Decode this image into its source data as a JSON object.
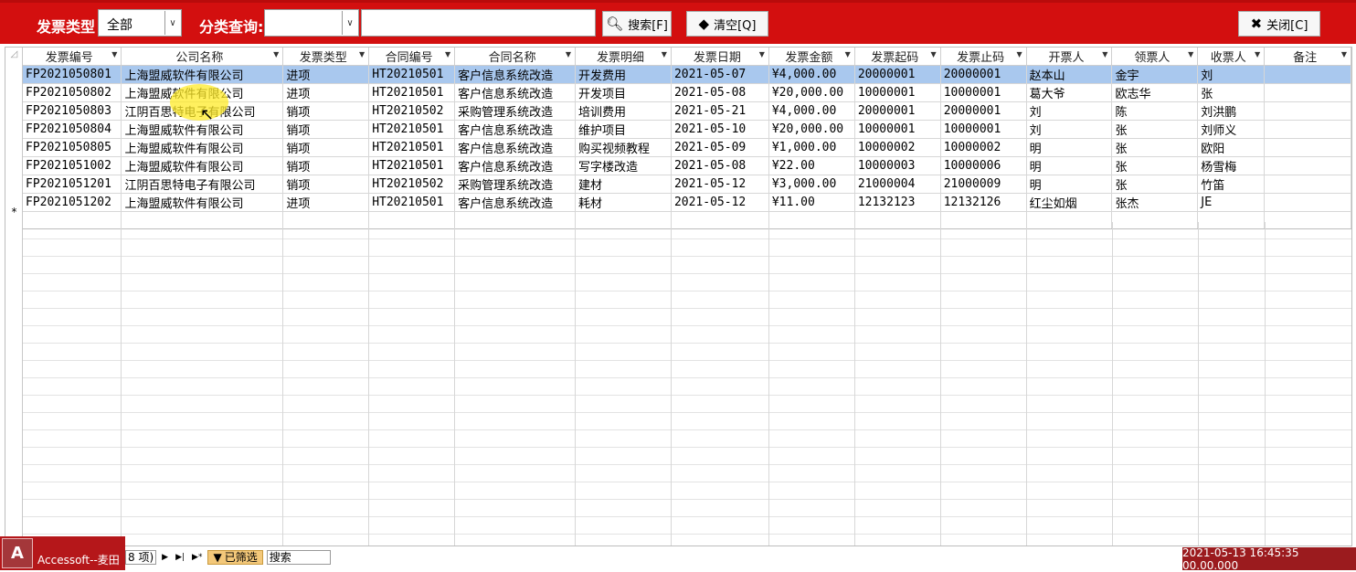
{
  "header": {
    "invoice_type_label": "发票类型",
    "invoice_type_value": "全部",
    "category_label": "分类查询:",
    "category_value": "",
    "query_value": "",
    "search_label": "搜索[F]",
    "clear_label": "清空[Q]",
    "close_label": "关闭[C]"
  },
  "columns": [
    "发票编号",
    "公司名称",
    "发票类型",
    "合同编号",
    "合同名称",
    "发票明细",
    "发票日期",
    "发票金额",
    "发票起码",
    "发票止码",
    "开票人",
    "领票人",
    "收票人",
    "备注"
  ],
  "rows": [
    [
      "FP2021050801",
      "上海盟威软件有限公司",
      "进项",
      "HT20210501",
      "客户信息系统改造",
      "开发费用",
      "2021-05-07",
      "¥4,000.00",
      "20000001",
      "20000001",
      "赵本山",
      "金宇",
      "刘",
      ""
    ],
    [
      "FP2021050802",
      "上海盟威软件有限公司",
      "进项",
      "HT20210501",
      "客户信息系统改造",
      "开发项目",
      "2021-05-08",
      "¥20,000.00",
      "10000001",
      "10000001",
      "葛大爷",
      "欧志华",
      "张",
      ""
    ],
    [
      "FP2021050803",
      "江阴百思特电子有限公司",
      "销项",
      "HT20210502",
      "采购管理系统改造",
      "培训费用",
      "2021-05-21",
      "¥4,000.00",
      "20000001",
      "20000001",
      "刘",
      "陈",
      "刘洪鹏",
      ""
    ],
    [
      "FP2021050804",
      "上海盟威软件有限公司",
      "销项",
      "HT20210501",
      "客户信息系统改造",
      "维护项目",
      "2021-05-10",
      "¥20,000.00",
      "10000001",
      "10000001",
      "刘",
      "张",
      "刘师义",
      ""
    ],
    [
      "FP2021050805",
      "上海盟威软件有限公司",
      "销项",
      "HT20210501",
      "客户信息系统改造",
      "购买视频教程",
      "2021-05-09",
      "¥1,000.00",
      "10000002",
      "10000002",
      "明",
      "张",
      "欧阳",
      ""
    ],
    [
      "FP2021051002",
      "上海盟威软件有限公司",
      "销项",
      "HT20210501",
      "客户信息系统改造",
      "写字楼改造",
      "2021-05-08",
      "¥22.00",
      "10000003",
      "10000006",
      "明",
      "张",
      "杨雪梅",
      ""
    ],
    [
      "FP2021051201",
      "江阴百思特电子有限公司",
      "销项",
      "HT20210502",
      "采购管理系统改造",
      "建材",
      "2021-05-12",
      "¥3,000.00",
      "21000004",
      "21000009",
      "明",
      "张",
      "竹笛",
      ""
    ],
    [
      "FP2021051202",
      "上海盟威软件有限公司",
      "进项",
      "HT20210501",
      "客户信息系统改造",
      "耗材",
      "2021-05-12",
      "¥11.00",
      "12132123",
      "12132126",
      "红尘如烟",
      "张杰",
      "JE",
      ""
    ]
  ],
  "new_row_marker": "*",
  "footer": {
    "app_icon_text": "A",
    "app_name": "Accessoft--麦田",
    "record_indicator": "8 项)",
    "filter_badge": "已筛选",
    "search_box": "搜索",
    "datetime": "2021-05-13 16:45:35 00.00.000"
  },
  "colors": {
    "header_bg": "#d30f0f",
    "selected_row_bg": "#a9c8ee",
    "footer_left_bg": "#b5171a",
    "footer_right_bg": "#9b1b1e"
  }
}
